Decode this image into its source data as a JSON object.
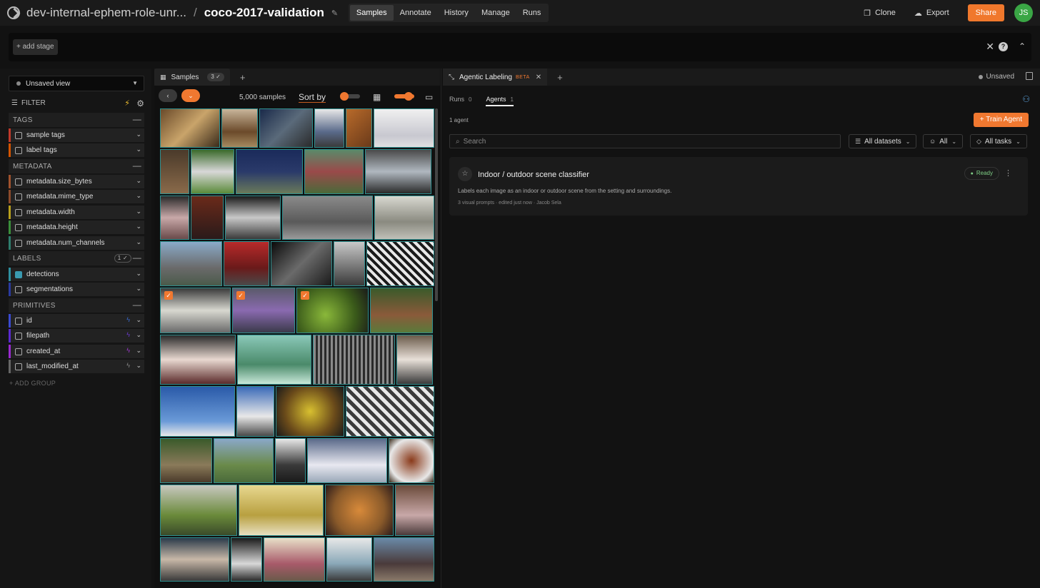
{
  "header": {
    "org": "dev-internal-ephem-role-unr...",
    "separator": "/",
    "dataset": "coco-2017-validation",
    "nav_tabs": [
      {
        "label": "Samples",
        "active": true
      },
      {
        "label": "Annotate",
        "active": false
      },
      {
        "label": "History",
        "active": false
      },
      {
        "label": "Manage",
        "active": false
      },
      {
        "label": "Runs",
        "active": false
      }
    ],
    "clone_label": "Clone",
    "export_label": "Export",
    "share_label": "Share",
    "avatar_initials": "JS"
  },
  "stage_bar": {
    "add_stage_label": "+ add stage"
  },
  "sidebar": {
    "view_label": "Unsaved view",
    "filter_label": "FILTER",
    "groups": [
      {
        "name": "TAGS",
        "fields": [
          {
            "label": "sample tags",
            "color": "#c0392b"
          },
          {
            "label": "label tags",
            "color": "#d35400"
          }
        ]
      },
      {
        "name": "METADATA",
        "fields": [
          {
            "label": "metadata.size_bytes",
            "color": "#a0522d"
          },
          {
            "label": "metadata.mime_type",
            "color": "#8b4a2b"
          },
          {
            "label": "metadata.width",
            "color": "#b8a01c"
          },
          {
            "label": "metadata.height",
            "color": "#3a8f3a"
          },
          {
            "label": "metadata.num_channels",
            "color": "#2e7d6d"
          }
        ]
      },
      {
        "name": "LABELS",
        "count": "1",
        "fields": [
          {
            "label": "detections",
            "color": "#2e8f9f",
            "checked": true
          },
          {
            "label": "segmentations",
            "color": "#2a3a9f"
          }
        ]
      },
      {
        "name": "PRIMITIVES",
        "fields": [
          {
            "label": "id",
            "color": "#3a4ad0"
          },
          {
            "label": "filepath",
            "color": "#5a2ad0"
          },
          {
            "label": "created_at",
            "color": "#9a2ad0"
          },
          {
            "label": "last_modified_at",
            "color": "#666666"
          }
        ]
      }
    ],
    "add_group_label": "+ ADD GROUP"
  },
  "grid_panel": {
    "tab_label": "Samples",
    "tab_count": "3",
    "sample_count": "5,000 samples",
    "sort_label": "Sort by"
  },
  "agent_panel": {
    "tab_label": "Agentic Labeling",
    "beta_label": "BETA",
    "unsaved_label": "Unsaved",
    "subtabs": [
      {
        "label": "Runs",
        "count": "0",
        "active": false
      },
      {
        "label": "Agents",
        "count": "1",
        "active": true
      }
    ],
    "agent_count": "1 agent",
    "train_label": "+ Train Agent",
    "search_placeholder": "Search",
    "filters": {
      "datasets": "All datasets",
      "owner": "All",
      "tasks": "All tasks"
    },
    "agent": {
      "name": "Indoor / outdoor scene classifier",
      "status": "Ready",
      "description": "Labels each image as an indoor or outdoor scene from the setting and surroundings.",
      "meta": "3 visual prompts · edited just now · Jacob Sela"
    }
  },
  "colors": {
    "accent": "#f07830",
    "avatar": "#3aa645",
    "ready": "#7fce85"
  }
}
